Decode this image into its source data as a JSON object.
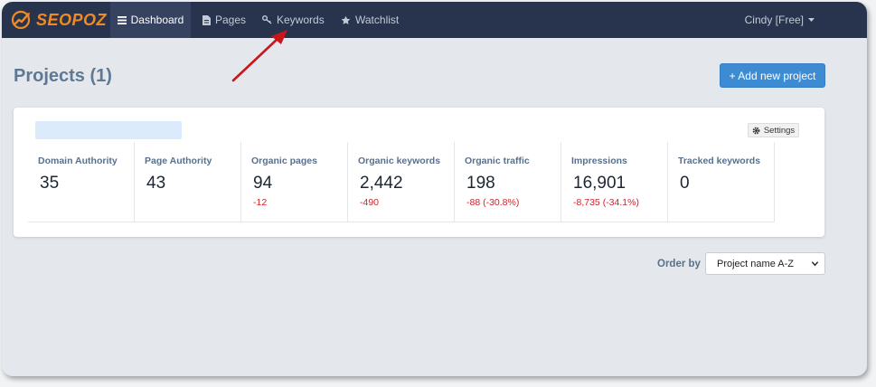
{
  "brand": {
    "name": "SEOPOZ"
  },
  "nav": {
    "items": [
      {
        "label": "Dashboard",
        "icon": "bars-icon",
        "active": true
      },
      {
        "label": "Pages",
        "icon": "document-icon",
        "active": false
      },
      {
        "label": "Keywords",
        "icon": "key-icon",
        "active": false
      },
      {
        "label": "Watchlist",
        "icon": "star-icon",
        "active": false
      }
    ],
    "user": "Cindy [Free]"
  },
  "page": {
    "title": "Projects (1)",
    "add_button": "+ Add new project"
  },
  "project": {
    "settings_label": "Settings",
    "metrics": [
      {
        "label": "Domain Authority",
        "value": "35",
        "change": ""
      },
      {
        "label": "Page Authority",
        "value": "43",
        "change": ""
      },
      {
        "label": "Organic pages",
        "value": "94",
        "change": "-12"
      },
      {
        "label": "Organic keywords",
        "value": "2,442",
        "change": "-490"
      },
      {
        "label": "Organic traffic",
        "value": "198",
        "change": "-88 (-30.8%)"
      },
      {
        "label": "Impressions",
        "value": "16,901",
        "change": "-8,735 (-34.1%)"
      },
      {
        "label": "Tracked keywords",
        "value": "0",
        "change": ""
      }
    ]
  },
  "order": {
    "label": "Order by",
    "selected": "Project name A-Z"
  },
  "colors": {
    "navbar": "#28344d",
    "accent": "#3d8bd3",
    "negative": "#d0242b",
    "annotation_arrow": "#c8161d"
  }
}
